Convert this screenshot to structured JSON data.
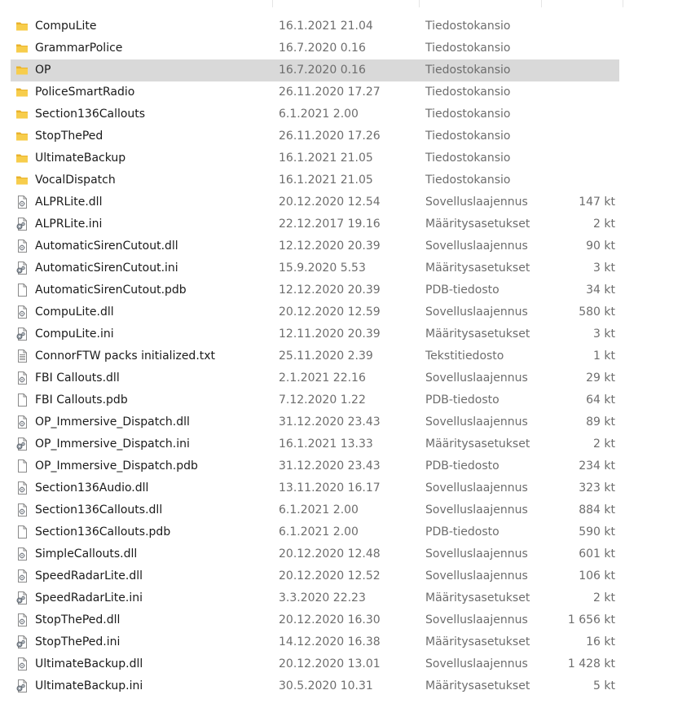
{
  "list": {
    "items": [
      {
        "name": "CompuLite",
        "date": "16.1.2021 21.04",
        "type": "Tiedostokansio",
        "size": "",
        "icon": "folder-icon"
      },
      {
        "name": "GrammarPolice",
        "date": "16.7.2020 0.16",
        "type": "Tiedostokansio",
        "size": "",
        "icon": "folder-icon"
      },
      {
        "name": "OP",
        "date": "16.7.2020 0.16",
        "type": "Tiedostokansio",
        "size": "",
        "icon": "folder-icon",
        "selected": true
      },
      {
        "name": "PoliceSmartRadio",
        "date": "26.11.2020 17.27",
        "type": "Tiedostokansio",
        "size": "",
        "icon": "folder-icon"
      },
      {
        "name": "Section136Callouts",
        "date": "6.1.2021 2.00",
        "type": "Tiedostokansio",
        "size": "",
        "icon": "folder-icon"
      },
      {
        "name": "StopThePed",
        "date": "26.11.2020 17.26",
        "type": "Tiedostokansio",
        "size": "",
        "icon": "folder-icon"
      },
      {
        "name": "UltimateBackup",
        "date": "16.1.2021 21.05",
        "type": "Tiedostokansio",
        "size": "",
        "icon": "folder-icon"
      },
      {
        "name": "VocalDispatch",
        "date": "16.1.2021 21.05",
        "type": "Tiedostokansio",
        "size": "",
        "icon": "folder-icon"
      },
      {
        "name": "ALPRLite.dll",
        "date": "20.12.2020 12.54",
        "type": "Sovelluslaajennus",
        "size": "147 kt",
        "icon": "dll-file-icon"
      },
      {
        "name": "ALPRLite.ini",
        "date": "22.12.2017 19.16",
        "type": "Määritysasetukset",
        "size": "2 kt",
        "icon": "ini-file-icon"
      },
      {
        "name": "AutomaticSirenCutout.dll",
        "date": "12.12.2020 20.39",
        "type": "Sovelluslaajennus",
        "size": "90 kt",
        "icon": "dll-file-icon"
      },
      {
        "name": "AutomaticSirenCutout.ini",
        "date": "15.9.2020 5.53",
        "type": "Määritysasetukset",
        "size": "3 kt",
        "icon": "ini-file-icon"
      },
      {
        "name": "AutomaticSirenCutout.pdb",
        "date": "12.12.2020 20.39",
        "type": "PDB-tiedosto",
        "size": "34 kt",
        "icon": "blank-file-icon"
      },
      {
        "name": "CompuLite.dll",
        "date": "20.12.2020 12.59",
        "type": "Sovelluslaajennus",
        "size": "580 kt",
        "icon": "dll-file-icon"
      },
      {
        "name": "CompuLite.ini",
        "date": "12.11.2020 20.39",
        "type": "Määritysasetukset",
        "size": "3 kt",
        "icon": "ini-file-icon"
      },
      {
        "name": "ConnorFTW packs initialized.txt",
        "date": "25.11.2020 2.39",
        "type": "Tekstitiedosto",
        "size": "1 kt",
        "icon": "text-file-icon"
      },
      {
        "name": "FBI Callouts.dll",
        "date": "2.1.2021 22.16",
        "type": "Sovelluslaajennus",
        "size": "29 kt",
        "icon": "dll-file-icon"
      },
      {
        "name": "FBI Callouts.pdb",
        "date": "7.12.2020 1.22",
        "type": "PDB-tiedosto",
        "size": "64 kt",
        "icon": "blank-file-icon"
      },
      {
        "name": "OP_Immersive_Dispatch.dll",
        "date": "31.12.2020 23.43",
        "type": "Sovelluslaajennus",
        "size": "89 kt",
        "icon": "dll-file-icon"
      },
      {
        "name": "OP_Immersive_Dispatch.ini",
        "date": "16.1.2021 13.33",
        "type": "Määritysasetukset",
        "size": "2 kt",
        "icon": "ini-file-icon"
      },
      {
        "name": "OP_Immersive_Dispatch.pdb",
        "date": "31.12.2020 23.43",
        "type": "PDB-tiedosto",
        "size": "234 kt",
        "icon": "blank-file-icon"
      },
      {
        "name": "Section136Audio.dll",
        "date": "13.11.2020 16.17",
        "type": "Sovelluslaajennus",
        "size": "323 kt",
        "icon": "dll-file-icon"
      },
      {
        "name": "Section136Callouts.dll",
        "date": "6.1.2021 2.00",
        "type": "Sovelluslaajennus",
        "size": "884 kt",
        "icon": "dll-file-icon"
      },
      {
        "name": "Section136Callouts.pdb",
        "date": "6.1.2021 2.00",
        "type": "PDB-tiedosto",
        "size": "590 kt",
        "icon": "blank-file-icon"
      },
      {
        "name": "SimpleCallouts.dll",
        "date": "20.12.2020 12.48",
        "type": "Sovelluslaajennus",
        "size": "601 kt",
        "icon": "dll-file-icon"
      },
      {
        "name": "SpeedRadarLite.dll",
        "date": "20.12.2020 12.52",
        "type": "Sovelluslaajennus",
        "size": "106 kt",
        "icon": "dll-file-icon"
      },
      {
        "name": "SpeedRadarLite.ini",
        "date": "3.3.2020 22.23",
        "type": "Määritysasetukset",
        "size": "2 kt",
        "icon": "ini-file-icon"
      },
      {
        "name": "StopThePed.dll",
        "date": "20.12.2020 16.30",
        "type": "Sovelluslaajennus",
        "size": "1 656 kt",
        "icon": "dll-file-icon"
      },
      {
        "name": "StopThePed.ini",
        "date": "14.12.2020 16.38",
        "type": "Määritysasetukset",
        "size": "16 kt",
        "icon": "ini-file-icon"
      },
      {
        "name": "UltimateBackup.dll",
        "date": "20.12.2020 13.01",
        "type": "Sovelluslaajennus",
        "size": "1 428 kt",
        "icon": "dll-file-icon"
      },
      {
        "name": "UltimateBackup.ini",
        "date": "30.5.2020 10.31",
        "type": "Määritysasetukset",
        "size": "5 kt",
        "icon": "ini-file-icon"
      }
    ]
  },
  "colors": {
    "folder": "#f3c12e",
    "selection": "#d9d9d9",
    "secondary_text": "#6d6d6d"
  }
}
